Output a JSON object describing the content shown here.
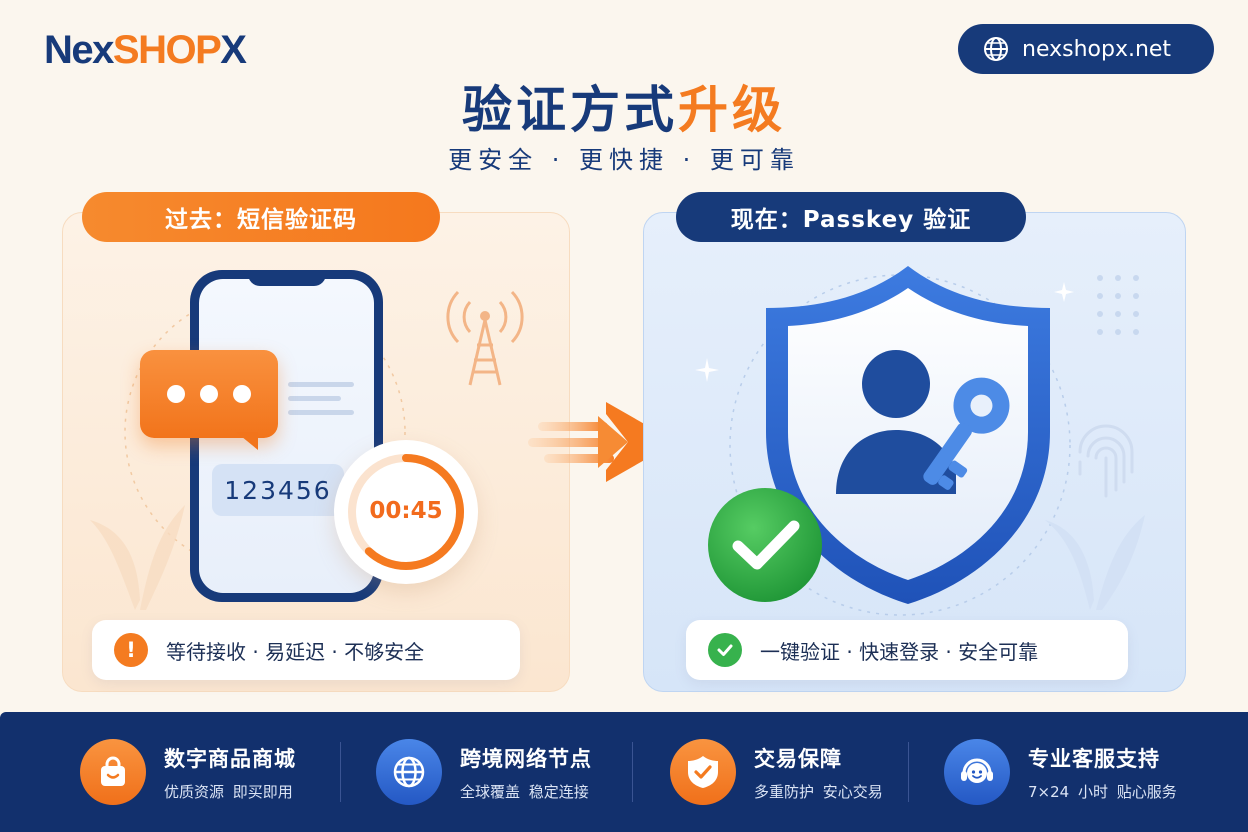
{
  "brand": {
    "logo_part1": "Nex",
    "logo_part2": "SHOP",
    "logo_part3": "X",
    "site": "nexshopx.net"
  },
  "headline": {
    "title_part1": "验证方式",
    "title_part2": "升级",
    "subtitle": "更安全 · 更快捷 · 更可靠"
  },
  "left_panel": {
    "label": "过去：短信验证码",
    "sms_code": "123456",
    "countdown": "00:45",
    "countdown_progress": 0.62,
    "status_text": "等待接收 · 易延迟 · 不够安全"
  },
  "right_panel": {
    "label": "现在：Passkey 验证",
    "status_text": "一键验证 · 快速登录 · 安全可靠"
  },
  "features": [
    {
      "icon": "shopping-bag-icon",
      "title": "数字商品商城",
      "sub": "优质资源  即买即用"
    },
    {
      "icon": "globe-icon",
      "title": "跨境网络节点",
      "sub": "全球覆盖  稳定连接"
    },
    {
      "icon": "shield-check-icon",
      "title": "交易保障",
      "sub": "多重防护  安心交易"
    },
    {
      "icon": "support-headset-icon",
      "title": "专业客服支持",
      "sub": "7×24 小时 贴心服务"
    }
  ],
  "colors": {
    "navy": "#173a7a",
    "orange": "#f47b20",
    "green": "#37b24d",
    "blue": "#2f6fd6"
  }
}
